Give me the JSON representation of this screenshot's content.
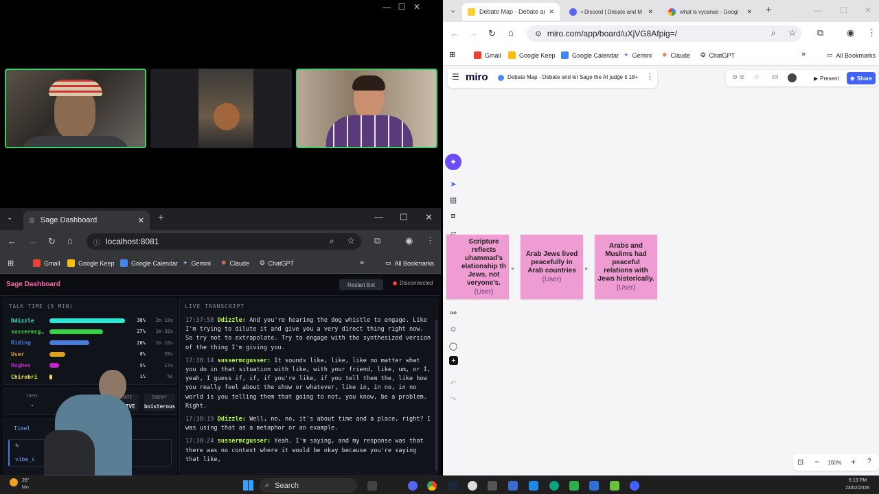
{
  "video_window": {
    "controls": [
      "—",
      "☐",
      "✕"
    ]
  },
  "sage_browser": {
    "tab_title": "Sage Dashboard",
    "url": "localhost:8081",
    "bookmarks": [
      "Gmail",
      "Google Keep",
      "Google Calendar",
      "Gemini",
      "Claude",
      "ChatGPT"
    ],
    "all_bookmarks": "All Bookmarks"
  },
  "sage": {
    "title": "Sage Dashboard",
    "restart_label": "Restart Bot",
    "status": "Disconnected",
    "talk_time_header": "TALK TIME (5 MIN)",
    "talk_time": [
      {
        "name": "Ddizzle",
        "pct": "38%",
        "time": "2m 10s",
        "color": "#2ee6d6",
        "level": 0.38
      },
      {
        "name": "sussermcg…",
        "pct": "27%",
        "time": "1m 32s",
        "color": "#3ad14a",
        "level": 0.27
      },
      {
        "name": "Riding",
        "pct": "20%",
        "time": "1m 10s",
        "color": "#4a7bd8",
        "level": 0.2
      },
      {
        "name": "User",
        "pct": "8%",
        "time": "28s",
        "color": "#e0a020",
        "level": 0.08
      },
      {
        "name": "Hughes",
        "pct": "5%",
        "time": "17s",
        "color": "#c026c9",
        "level": 0.05
      },
      {
        "name": "Chirobri",
        "pct": "1%",
        "time": "5s",
        "color": "#f2e63a",
        "level": 0.01
      }
    ],
    "stats": [
      {
        "label": "TOPIC",
        "value": "-"
      },
      {
        "label": "STATE",
        "value": "ACTIVE"
      },
      {
        "label": "ENERGY",
        "value": "boisterous"
      }
    ],
    "timeline_label": "Timel",
    "vibe_label": "vibe_c",
    "transcript_header": "LIVE TRANSCRIPT",
    "transcript": [
      {
        "ts": "17:37:58",
        "speaker": "Ddizzle:",
        "text": "And you're hearing the dog whistle to engage. Like I'm trying to dilute it and give you a very direct thing right now. So try not to extrapolate. Try to engage with the synthesized version of the thing I'm giving you."
      },
      {
        "ts": "17:38:14",
        "speaker": "sussermcgusser:",
        "text": "It sounds like, like, like no matter what you do in that situation with like, with your friend, like, um, or I, yeah, I guess if, if, if you're like, if you tell them the, like how you really feel about the show or whatever, like in, in no, in no world is you telling them that going to not, you know, be a problem. Right."
      },
      {
        "ts": "17:38:19",
        "speaker": "Ddizzle:",
        "text": "Well, no, no, it's about time and a place, right? I was using that as a metaphor or an example."
      },
      {
        "ts": "17:38:24",
        "speaker": "sussermcgusser:",
        "text": "Yeah. I'm saying, and my response was that there was no context where it would be okay because you're saying that like,"
      }
    ]
  },
  "right_browser": {
    "tabs": [
      "Debate Map - Debate an",
      "• Discord | Debate and M",
      "what is vycanse - Googl"
    ],
    "url": "miro.com/app/board/uXjVG8Afpig=/",
    "bookmarks": [
      "Gmail",
      "Google Keep",
      "Google Calendar",
      "Gemini",
      "Claude",
      "ChatGPT"
    ],
    "all_bookmarks": "All Bookmarks"
  },
  "miro": {
    "logo": "miro",
    "board_name": "Debate Map - Debate and let Sage the AI judge it 18+",
    "present_label": "Present",
    "share_label": "Share",
    "zoom": "100%",
    "stickies": [
      {
        "text": "Scripture reflects uhammad's elationship th Jews, not veryone's.",
        "tag": "(User)"
      },
      {
        "text": "Arab Jews lived peacefully in Arab countries",
        "tag": "(User)"
      },
      {
        "text": "Arabs and Muslims had peaceful relations with Jews historically.",
        "tag": "(User)"
      }
    ]
  },
  "taskbar": {
    "weather": "26°",
    "weather_sub": "Mo",
    "search": "Search",
    "time": "6:13 PM",
    "date": "23/02/2026"
  }
}
